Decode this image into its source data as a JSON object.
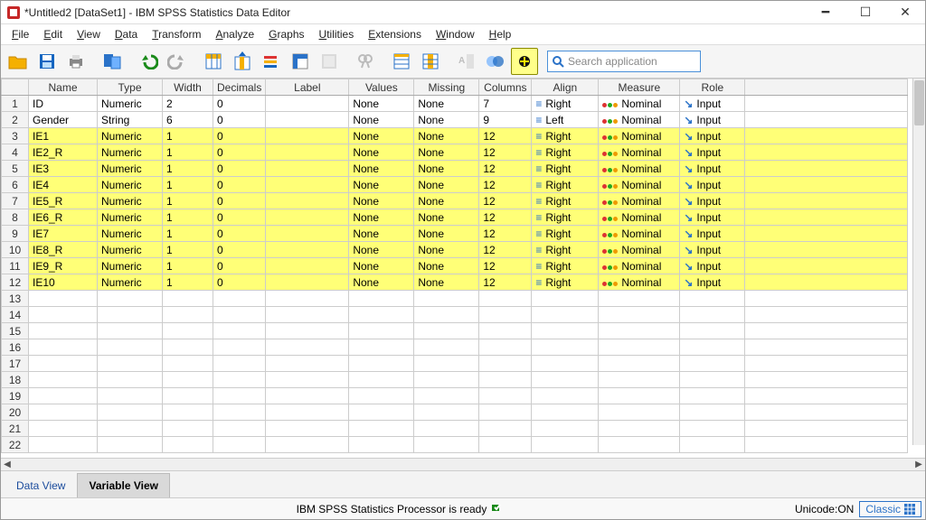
{
  "titlebar": {
    "title": "*Untitled2 [DataSet1] - IBM SPSS Statistics Data Editor"
  },
  "menu": {
    "items": [
      "File",
      "Edit",
      "View",
      "Data",
      "Transform",
      "Analyze",
      "Graphs",
      "Utilities",
      "Extensions",
      "Window",
      "Help"
    ]
  },
  "toolbar": {
    "search_placeholder": "Search application"
  },
  "grid": {
    "headers": [
      "Name",
      "Type",
      "Width",
      "Decimals",
      "Label",
      "Values",
      "Missing",
      "Columns",
      "Align",
      "Measure",
      "Role"
    ],
    "rows": [
      {
        "n": 1,
        "name": "ID",
        "type": "Numeric",
        "width": "2",
        "decimals": "0",
        "label": "",
        "values": "None",
        "missing": "None",
        "columns": "7",
        "align": "Right",
        "measure": "Nominal",
        "role": "Input",
        "hl": false
      },
      {
        "n": 2,
        "name": "Gender",
        "type": "String",
        "width": "6",
        "decimals": "0",
        "label": "",
        "values": "None",
        "missing": "None",
        "columns": "9",
        "align": "Left",
        "measure": "Nominal",
        "role": "Input",
        "hl": false
      },
      {
        "n": 3,
        "name": "IE1",
        "type": "Numeric",
        "width": "1",
        "decimals": "0",
        "label": "",
        "values": "None",
        "missing": "None",
        "columns": "12",
        "align": "Right",
        "measure": "Nominal",
        "role": "Input",
        "hl": true
      },
      {
        "n": 4,
        "name": "IE2_R",
        "type": "Numeric",
        "width": "1",
        "decimals": "0",
        "label": "",
        "values": "None",
        "missing": "None",
        "columns": "12",
        "align": "Right",
        "measure": "Nominal",
        "role": "Input",
        "hl": true
      },
      {
        "n": 5,
        "name": "IE3",
        "type": "Numeric",
        "width": "1",
        "decimals": "0",
        "label": "",
        "values": "None",
        "missing": "None",
        "columns": "12",
        "align": "Right",
        "measure": "Nominal",
        "role": "Input",
        "hl": true
      },
      {
        "n": 6,
        "name": "IE4",
        "type": "Numeric",
        "width": "1",
        "decimals": "0",
        "label": "",
        "values": "None",
        "missing": "None",
        "columns": "12",
        "align": "Right",
        "measure": "Nominal",
        "role": "Input",
        "hl": true
      },
      {
        "n": 7,
        "name": "IE5_R",
        "type": "Numeric",
        "width": "1",
        "decimals": "0",
        "label": "",
        "values": "None",
        "missing": "None",
        "columns": "12",
        "align": "Right",
        "measure": "Nominal",
        "role": "Input",
        "hl": true
      },
      {
        "n": 8,
        "name": "IE6_R",
        "type": "Numeric",
        "width": "1",
        "decimals": "0",
        "label": "",
        "values": "None",
        "missing": "None",
        "columns": "12",
        "align": "Right",
        "measure": "Nominal",
        "role": "Input",
        "hl": true
      },
      {
        "n": 9,
        "name": "IE7",
        "type": "Numeric",
        "width": "1",
        "decimals": "0",
        "label": "",
        "values": "None",
        "missing": "None",
        "columns": "12",
        "align": "Right",
        "measure": "Nominal",
        "role": "Input",
        "hl": true
      },
      {
        "n": 10,
        "name": "IE8_R",
        "type": "Numeric",
        "width": "1",
        "decimals": "0",
        "label": "",
        "values": "None",
        "missing": "None",
        "columns": "12",
        "align": "Right",
        "measure": "Nominal",
        "role": "Input",
        "hl": true
      },
      {
        "n": 11,
        "name": "IE9_R",
        "type": "Numeric",
        "width": "1",
        "decimals": "0",
        "label": "",
        "values": "None",
        "missing": "None",
        "columns": "12",
        "align": "Right",
        "measure": "Nominal",
        "role": "Input",
        "hl": true
      },
      {
        "n": 12,
        "name": "IE10",
        "type": "Numeric",
        "width": "1",
        "decimals": "0",
        "label": "",
        "values": "None",
        "missing": "None",
        "columns": "12",
        "align": "Right",
        "measure": "Nominal",
        "role": "Input",
        "hl": true
      }
    ],
    "empty_rows_from": 13,
    "empty_rows_to": 22
  },
  "tabs": {
    "data_view": "Data View",
    "variable_view": "Variable View"
  },
  "status": {
    "center": "IBM SPSS Statistics Processor is ready",
    "unicode": "Unicode:ON",
    "classic": "Classic"
  }
}
